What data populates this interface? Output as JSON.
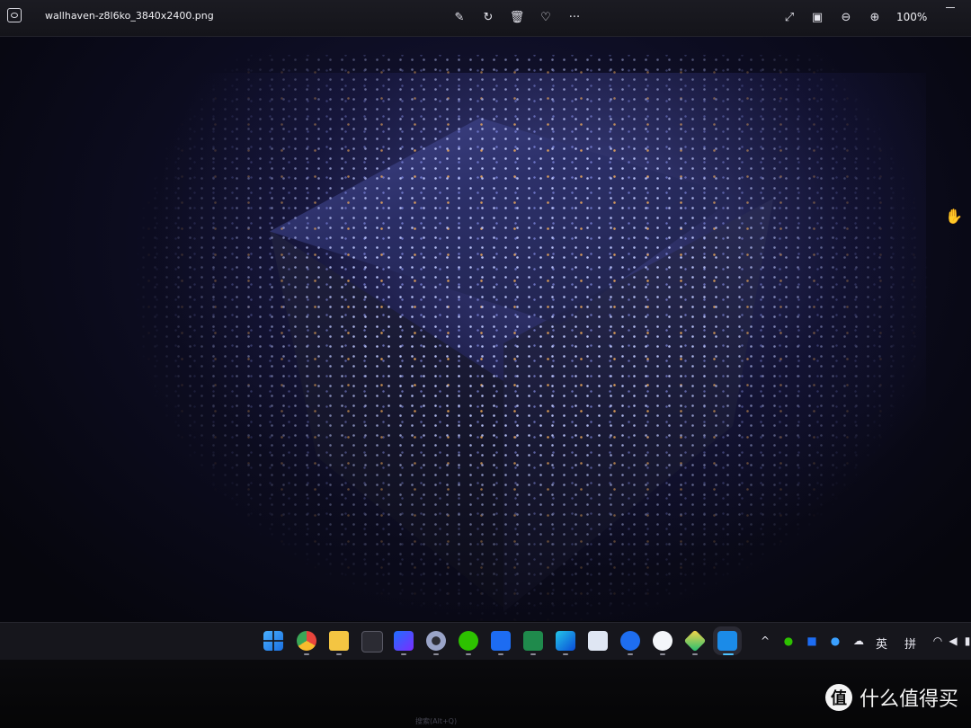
{
  "viewer": {
    "file_title": "wallhaven-z8l6ko_3840x2400.png",
    "zoom_level": "100%",
    "toolbar_icons": [
      "edit-icon",
      "rotate-icon",
      "delete-icon",
      "favorite-icon",
      "more-icon"
    ],
    "view_icons": [
      "fit-icon",
      "fullscreen-icon",
      "zoom-out-icon",
      "zoom-in-icon"
    ]
  },
  "taskbar": {
    "apps": [
      "start",
      "chrome",
      "file-explorer",
      "terminal",
      "intellij",
      "settings",
      "wechat",
      "feishu",
      "excel",
      "webstorm",
      "monitor",
      "maps",
      "cloud-upload",
      "tool",
      "photos"
    ],
    "tray_ime_1": "英",
    "tray_ime_2": "拼",
    "tray_icons": [
      "chevron-up-icon",
      "wechat-icon",
      "feishu-icon",
      "app-icon",
      "cloud-icon",
      "wifi-icon",
      "volume-icon",
      "battery-icon"
    ]
  },
  "bottom": {
    "search_hint": "搜索(Alt+Q)",
    "watermark_glyph": "值",
    "watermark_text": "什么值得买"
  }
}
